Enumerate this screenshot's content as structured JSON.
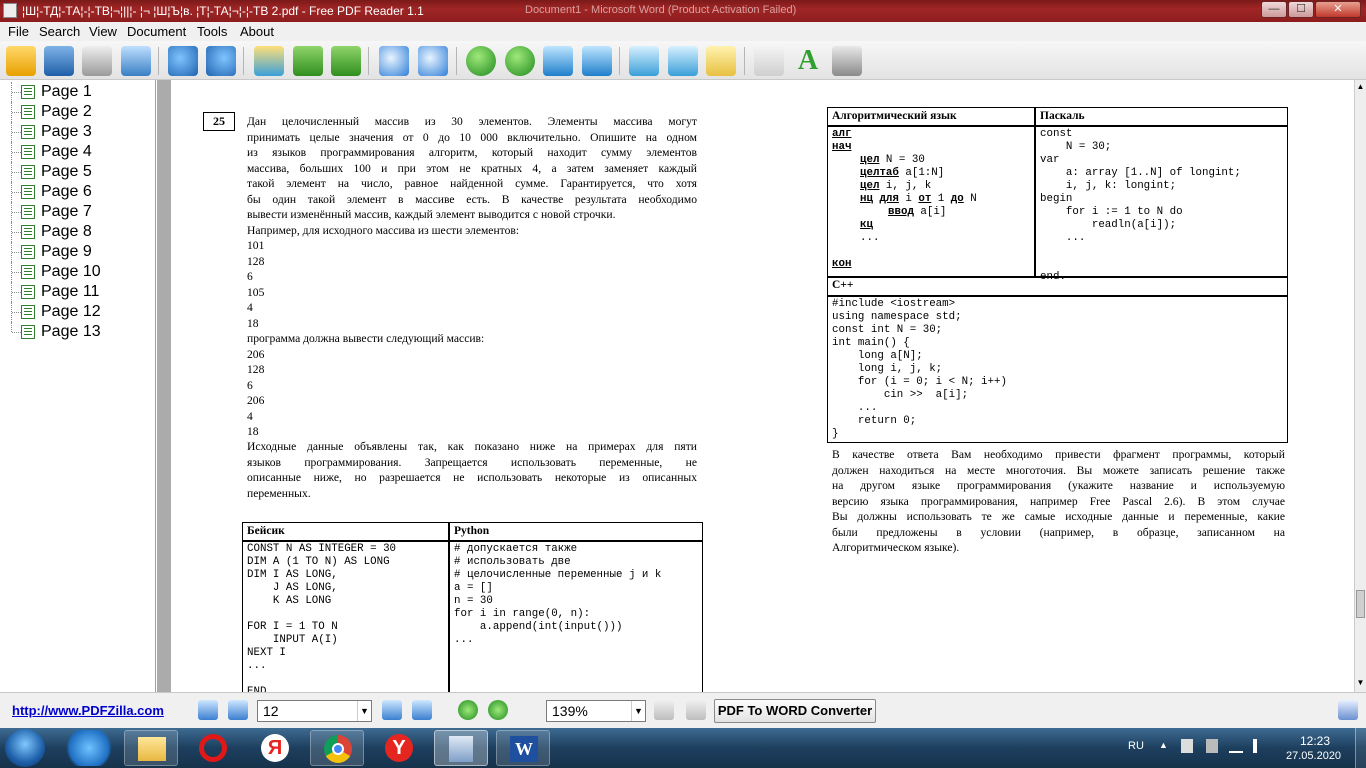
{
  "window": {
    "title": "¦Ш¦-ТД¦-ТА¦-¦-ТВ¦¬¦||¦- ¦¬ ¦Ш¦Ъ¦в. ¦Т¦-ТА¦¬¦-¦-ТВ 2.pdf - Free PDF Reader 1.1",
    "bg_title_1": "Document1 - Microsoft Word (Product Activation Failed)",
    "bg_title_2": "",
    "minimize": "—",
    "maximize": "☐",
    "close": "✕"
  },
  "menu": [
    "File",
    "Search",
    "View",
    "Document",
    "Tools",
    "About"
  ],
  "toolbar": [
    "open-icon",
    "save-icon",
    "print-icon",
    "email-icon",
    "undo-icon",
    "redo-icon",
    "image-icon",
    "rotate-icon",
    "swap-icon",
    "zoom-out-icon",
    "zoom-in-icon",
    "prev-icon",
    "next-icon",
    "first-icon",
    "last-icon",
    "thumbs-icon",
    "copy-icon",
    "paper-icon",
    "hand-tool-icon",
    "text-tool-icon",
    "snapshot-icon"
  ],
  "pages": [
    "Page 1",
    "Page 2",
    "Page 3",
    "Page 4",
    "Page 5",
    "Page 6",
    "Page 7",
    "Page 8",
    "Page 9",
    "Page 10",
    "Page 11",
    "Page 12",
    "Page 13"
  ],
  "doc": {
    "task_number": "25",
    "para1": [
      "Дан целочисленный массив из 30 элементов. Элементы массива могут",
      "принимать целые значения от 0 до 10 000 включительно. Опишите на одном",
      "из языков программирования алгоритм, который находит сумму элементов",
      "массива, больших 100 и при этом не кратных 4, а затем заменяет каждый",
      "такой элемент на число, равное найденной сумме. Гарантируется, что хотя",
      "бы один такой элемент в массиве есть. В качестве результата необходимо"
    ],
    "para1_last": "вывести изменённый массив, каждый элемент выводится с новой строчки.",
    "example_intro": "Например, для исходного массива из шести элементов:",
    "input_values": [
      "101",
      "128",
      "6",
      "105",
      "4",
      "18"
    ],
    "output_intro": "программа должна вывести следующий массив:",
    "output_values": [
      "206",
      "128",
      "6",
      "206",
      "4",
      "18"
    ],
    "para2": [
      "Исходные данные объявлены так, как показано ниже на примерах для пяти",
      "языков программирования. Запрещается использовать переменные, не",
      "описанные ниже, но разрешается не использовать некоторые из описанных"
    ],
    "para2_last": "переменных.",
    "basic_header": "Бейсик",
    "python_header": "Python",
    "basic_code": "CONST N AS INTEGER = 30\nDIM A (1 TO N) AS LONG\nDIM I AS LONG,\n    J AS LONG,\n    K AS LONG\n\nFOR I = 1 TO N\n    INPUT A(I)\nNEXT I\n...\n\nEND",
    "python_code": "# допускается также\n# использовать две\n# целочисленные переменные j и k\na = []\nn = 30\nfor i in range(0, n):\n    a.append(int(input()))\n...",
    "alg_header": "Алгоритмический язык",
    "pascal_header": "Паскаль",
    "alg_kw_alg": "алг",
    "alg_kw_nach": "нач",
    "alg_line1_kw": "цел",
    "alg_line1": " N = 30",
    "alg_line2_kw": "целтаб",
    "alg_line2": " a[1:N]",
    "alg_line3_kw": "цел",
    "alg_line3": " i, j, k",
    "alg_line4_kw1": "нц",
    "alg_line4_kw2": "для",
    "alg_line4_a": " i ",
    "alg_line4_kw3": "от",
    "alg_line4_b": " 1 ",
    "alg_line4_kw4": "до",
    "alg_line4_c": " N",
    "alg_line5_kw": "ввод",
    "alg_line5": " a[i]",
    "alg_kw_kc": "кц",
    "alg_dots": "...",
    "alg_kw_kon": "кон",
    "pascal_code": "const\n    N = 30;\nvar\n    a: array [1..N] of longint;\n    i, j, k: longint;\nbegin\n    for i := 1 to N do\n        readln(a[i]);\n    ...\n\n\nend.",
    "cpp_header": "C++",
    "cpp_code": "#include <iostream>\nusing namespace std;\nconst int N = 30;\nint main() {\n    long a[N];\n    long i, j, k;\n    for (i = 0; i < N; i++)\n        cin >>  a[i];\n    ...\n    return 0;\n}",
    "para3": [
      "В качестве ответа Вам необходимо привести фрагмент программы, который",
      "должен находиться на месте многоточия. Вы можете записать решение также",
      "на другом языке программирования (укажите название и используемую",
      "версию языка программирования, например Free Pascal 2.6). В этом случае",
      "Вы должны использовать те же самые исходные данные и переменные, какие",
      "были предложены в условии (например, в образце, записанном на"
    ],
    "para3_last": "Алгоритмическом языке)."
  },
  "status": {
    "link": "http://www.PDFZilla.com",
    "page_value": "12",
    "zoom_value": "139%",
    "convert_button": "PDF To WORD Converter"
  },
  "tray": {
    "lang": "RU",
    "time": "12:23",
    "date": "27.05.2020"
  },
  "taskbar": [
    "windows-start-icon",
    "ie-icon",
    "explorer-icon",
    "opera-icon",
    "yandex-icon",
    "chrome-icon",
    "yandex-browser-icon",
    "pdf-reader-icon",
    "word-icon"
  ]
}
